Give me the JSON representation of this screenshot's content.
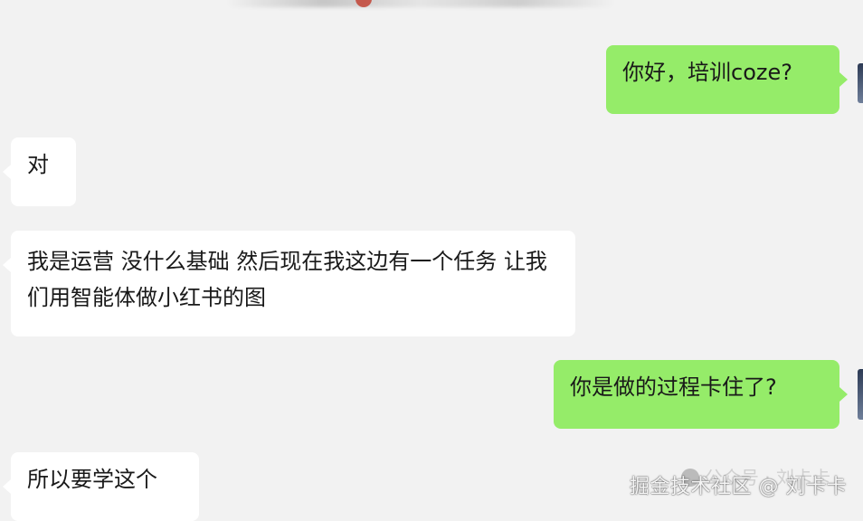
{
  "messages": [
    {
      "side": "right",
      "text": "你好，培训coze?"
    },
    {
      "side": "left",
      "text": "对"
    },
    {
      "side": "left",
      "text": "我是运营 没什么基础 然后现在我这边有一个任务 让我们用智能体做小红书的图"
    },
    {
      "side": "right",
      "text": "你是做的过程卡住了?"
    },
    {
      "side": "left",
      "text": "所以要学这个"
    }
  ],
  "watermark": {
    "main": "掘金技术社区 @ 刘卡卡",
    "ghost": "公众号 · 刘卡卡"
  },
  "colors": {
    "background": "#f2f2f2",
    "outgoing_bubble": "#95ec69",
    "incoming_bubble": "#ffffff"
  }
}
